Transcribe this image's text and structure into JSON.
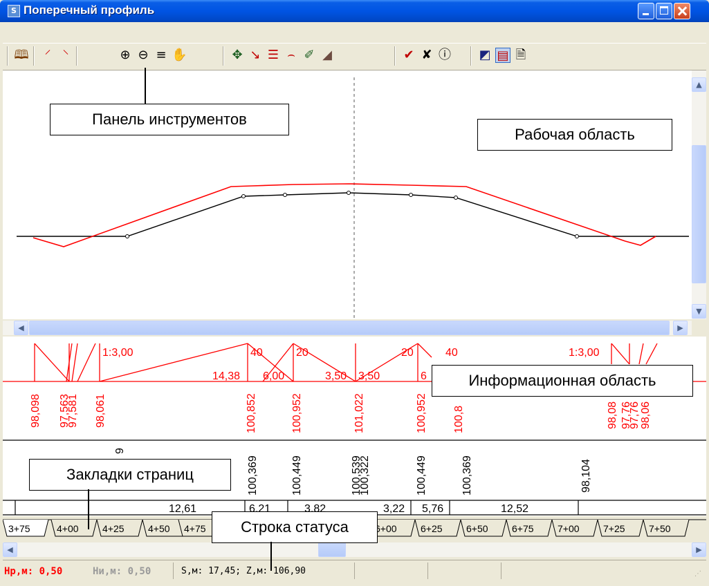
{
  "window": {
    "title": "Поперечный профиль",
    "app_icon_glyph": "S"
  },
  "toolbar": {
    "icons": [
      "book-icon",
      "add-point-icon",
      "delete-point-icon",
      "zoom-in-icon",
      "zoom-out-icon",
      "layers-icon",
      "pan-hand-icon",
      "move-point-icon",
      "draw-line-icon",
      "slope-icon",
      "curve-icon",
      "cut-icon",
      "terrain-icon",
      "insert-vertex-icon",
      "move-vertex-icon",
      "info-icon",
      "fill-icon",
      "table-icon",
      "properties-icon"
    ]
  },
  "callouts": {
    "toolbar": "Панель инструментов",
    "workarea": "Рабочая область",
    "infoarea": "Информационная область",
    "tabs": "Закладки страниц",
    "statusbar": "Строка статуса"
  },
  "info": {
    "slope_labels": [
      "1:3,00",
      "40",
      "20",
      "20",
      "40",
      "1:3,00"
    ],
    "width_labels": [
      "14,38",
      "6,00",
      "3,50",
      "3,50",
      "6"
    ],
    "red_marks": [
      "98,098",
      "97,563",
      "97,581",
      "98,061",
      "100,852",
      "100,952",
      "101,022",
      "100,952",
      "100,8",
      "98,08",
      "97,76",
      "97,76",
      "98,06"
    ],
    "black_marks": [
      "9",
      "100,369",
      "100,449",
      "100,539",
      "100,322",
      "100,449",
      "100,369",
      "98,104"
    ],
    "distances": [
      "12,61",
      "6,21",
      "3,82",
      "3,22",
      "5,76",
      "12,52"
    ]
  },
  "tabs": [
    "3+75",
    "4+00",
    "4+25",
    "4+50",
    "4+75",
    "6+00",
    "6+25",
    "6+50",
    "6+75",
    "7+00",
    "7+25",
    "7+50",
    "7+75"
  ],
  "statusbar": {
    "hr": "Нр,м: 0,50",
    "hi": "Ни,м: 0,50",
    "coords": "S,м: 17,45; Z,м: 106,90"
  },
  "colors": {
    "design_line": "#ff0000",
    "ground_line": "#000000",
    "titlebar": "#0054e3"
  }
}
